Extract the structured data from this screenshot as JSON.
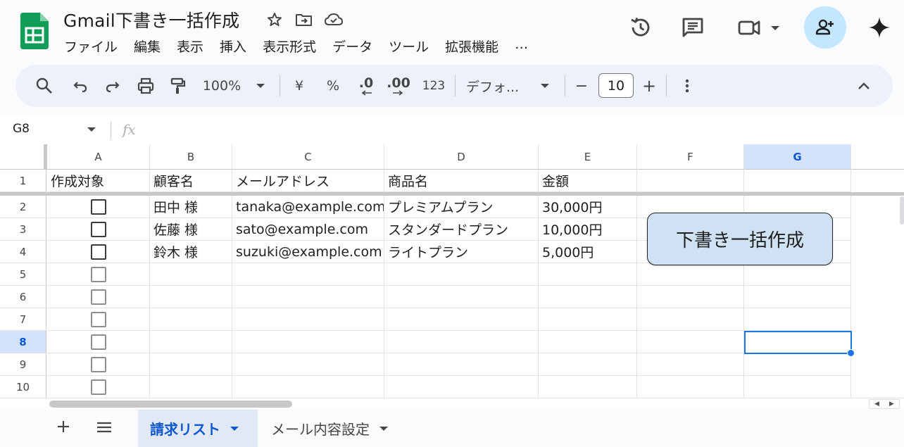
{
  "document": {
    "title": "Gmail下書き一括作成"
  },
  "menu": [
    "ファイル",
    "編集",
    "表示",
    "挿入",
    "表示形式",
    "データ",
    "ツール",
    "拡張機能",
    "…"
  ],
  "toolbar": {
    "zoom": "100%",
    "currency": "¥",
    "percent": "%",
    "dec_decrease": ".0",
    "dec_increase": ".00",
    "number_format": "123",
    "font": "デフォ...",
    "minus": "−",
    "font_size": "10",
    "plus": "+"
  },
  "formula_bar": {
    "name_box": "G8",
    "fx": "fx"
  },
  "grid": {
    "columns": [
      "A",
      "B",
      "C",
      "D",
      "E",
      "F",
      "G"
    ],
    "selected_column": "G",
    "rows": [
      "1",
      "2",
      "3",
      "4",
      "5",
      "6",
      "7",
      "8",
      "9",
      "10"
    ],
    "selected_row": "8",
    "header_row": [
      "作成対象",
      "顧客名",
      "メールアドレス",
      "商品名",
      "金額",
      "",
      ""
    ],
    "data_rows": [
      {
        "checked": false,
        "customer": "田中 様",
        "email": "tanaka@example.com",
        "product": "プレミアムプラン",
        "amount": "30,000円"
      },
      {
        "checked": false,
        "customer": "佐藤 様",
        "email": "sato@example.com",
        "product": "スタンダードプラン",
        "amount": "10,000円"
      },
      {
        "checked": false,
        "customer": "鈴木 様",
        "email": "suzuki@example.com",
        "product": "ライトプラン",
        "amount": "5,000円"
      }
    ]
  },
  "draw_button": {
    "label": "下書き一括作成"
  },
  "sheet_tabs": [
    {
      "label": "請求リスト",
      "active": true
    },
    {
      "label": "メール内容設定",
      "active": false
    }
  ],
  "colors": {
    "accent": "#0b57d0",
    "selection": "#1a73e8",
    "button_fill": "#cfe2f3",
    "sheets_green": "#0f9d58"
  }
}
